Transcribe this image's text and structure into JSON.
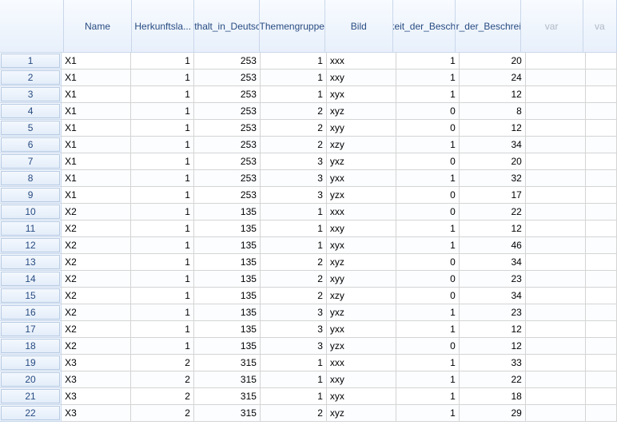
{
  "columns": {
    "name": "Name",
    "herkunft": "Herkunftsla...",
    "aufenthalt": "Aufenthalt_in_Deutschland",
    "themen": "Themengruppe",
    "bild": "Bild",
    "richtig": "Richtigkeit_der_Beschreibung",
    "dauer": "Dauer_der_Beschreibung",
    "var1": "var",
    "var2": "va"
  },
  "rows": [
    {
      "n": "1",
      "name": "X1",
      "herk": "1",
      "auf": "253",
      "them": "1",
      "bild": "xxx",
      "richt": "1",
      "dauer": "20"
    },
    {
      "n": "2",
      "name": "X1",
      "herk": "1",
      "auf": "253",
      "them": "1",
      "bild": "xxy",
      "richt": "1",
      "dauer": "24"
    },
    {
      "n": "3",
      "name": "X1",
      "herk": "1",
      "auf": "253",
      "them": "1",
      "bild": "xyx",
      "richt": "1",
      "dauer": "12"
    },
    {
      "n": "4",
      "name": "X1",
      "herk": "1",
      "auf": "253",
      "them": "2",
      "bild": "xyz",
      "richt": "0",
      "dauer": "8"
    },
    {
      "n": "5",
      "name": "X1",
      "herk": "1",
      "auf": "253",
      "them": "2",
      "bild": "xyy",
      "richt": "0",
      "dauer": "12"
    },
    {
      "n": "6",
      "name": "X1",
      "herk": "1",
      "auf": "253",
      "them": "2",
      "bild": "xzy",
      "richt": "1",
      "dauer": "34"
    },
    {
      "n": "7",
      "name": "X1",
      "herk": "1",
      "auf": "253",
      "them": "3",
      "bild": "yxz",
      "richt": "0",
      "dauer": "20"
    },
    {
      "n": "8",
      "name": "X1",
      "herk": "1",
      "auf": "253",
      "them": "3",
      "bild": "yxx",
      "richt": "1",
      "dauer": "32"
    },
    {
      "n": "9",
      "name": "X1",
      "herk": "1",
      "auf": "253",
      "them": "3",
      "bild": "yzx",
      "richt": "0",
      "dauer": "17"
    },
    {
      "n": "10",
      "name": "X2",
      "herk": "1",
      "auf": "135",
      "them": "1",
      "bild": "xxx",
      "richt": "0",
      "dauer": "22"
    },
    {
      "n": "11",
      "name": "X2",
      "herk": "1",
      "auf": "135",
      "them": "1",
      "bild": "xxy",
      "richt": "1",
      "dauer": "12"
    },
    {
      "n": "12",
      "name": "X2",
      "herk": "1",
      "auf": "135",
      "them": "1",
      "bild": "xyx",
      "richt": "1",
      "dauer": "46"
    },
    {
      "n": "13",
      "name": "X2",
      "herk": "1",
      "auf": "135",
      "them": "2",
      "bild": "xyz",
      "richt": "0",
      "dauer": "34"
    },
    {
      "n": "14",
      "name": "X2",
      "herk": "1",
      "auf": "135",
      "them": "2",
      "bild": "xyy",
      "richt": "0",
      "dauer": "23"
    },
    {
      "n": "15",
      "name": "X2",
      "herk": "1",
      "auf": "135",
      "them": "2",
      "bild": "xzy",
      "richt": "0",
      "dauer": "34"
    },
    {
      "n": "16",
      "name": "X2",
      "herk": "1",
      "auf": "135",
      "them": "3",
      "bild": "yxz",
      "richt": "1",
      "dauer": "23"
    },
    {
      "n": "17",
      "name": "X2",
      "herk": "1",
      "auf": "135",
      "them": "3",
      "bild": "yxx",
      "richt": "1",
      "dauer": "12"
    },
    {
      "n": "18",
      "name": "X2",
      "herk": "1",
      "auf": "135",
      "them": "3",
      "bild": "yzx",
      "richt": "0",
      "dauer": "12"
    },
    {
      "n": "19",
      "name": "X3",
      "herk": "2",
      "auf": "315",
      "them": "1",
      "bild": "xxx",
      "richt": "1",
      "dauer": "33"
    },
    {
      "n": "20",
      "name": "X3",
      "herk": "2",
      "auf": "315",
      "them": "1",
      "bild": "xxy",
      "richt": "1",
      "dauer": "22"
    },
    {
      "n": "21",
      "name": "X3",
      "herk": "2",
      "auf": "315",
      "them": "1",
      "bild": "xyx",
      "richt": "1",
      "dauer": "18"
    },
    {
      "n": "22",
      "name": "X3",
      "herk": "2",
      "auf": "315",
      "them": "2",
      "bild": "xyz",
      "richt": "1",
      "dauer": "29"
    }
  ]
}
